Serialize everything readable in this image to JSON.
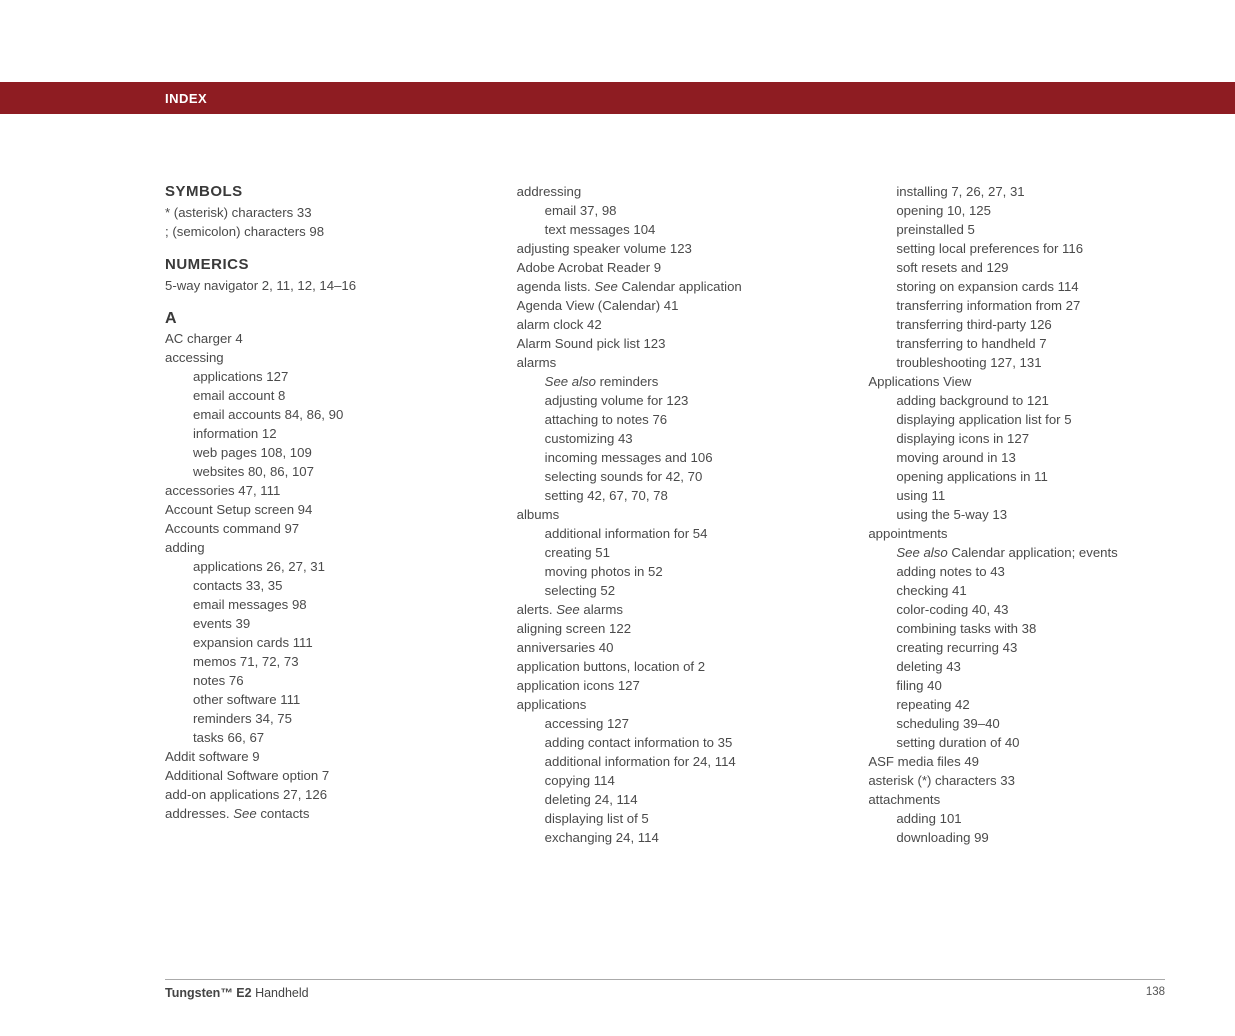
{
  "header": {
    "title": "INDEX"
  },
  "footer": {
    "product_bold": "Tungsten™ E2",
    "product_rest": " Handheld",
    "page": "138"
  },
  "col1": [
    {
      "cls": "heading",
      "txt": "SYMBOLS"
    },
    {
      "cls": "entry",
      "txt": "* (asterisk) characters 33"
    },
    {
      "cls": "entry",
      "txt": "; (semicolon) characters 98"
    },
    {
      "cls": "spacer"
    },
    {
      "cls": "heading",
      "txt": "NUMERICS"
    },
    {
      "cls": "entry",
      "txt": "5-way navigator 2, 11, 12, 14–16"
    },
    {
      "cls": "letter-heading",
      "txt": "A"
    },
    {
      "cls": "entry",
      "txt": "AC charger 4"
    },
    {
      "cls": "entry",
      "txt": "accessing"
    },
    {
      "cls": "sub1",
      "txt": "applications 127"
    },
    {
      "cls": "sub1",
      "txt": "email account 8"
    },
    {
      "cls": "sub1",
      "txt": "email accounts 84, 86, 90"
    },
    {
      "cls": "sub1",
      "txt": "information 12"
    },
    {
      "cls": "sub1",
      "txt": "web pages 108, 109"
    },
    {
      "cls": "sub1",
      "txt": "websites 80, 86, 107"
    },
    {
      "cls": "entry",
      "txt": "accessories 47, 111"
    },
    {
      "cls": "entry",
      "txt": "Account Setup screen 94"
    },
    {
      "cls": "entry",
      "txt": "Accounts command 97"
    },
    {
      "cls": "entry",
      "txt": "adding"
    },
    {
      "cls": "sub1",
      "txt": "applications 26, 27, 31"
    },
    {
      "cls": "sub1",
      "txt": "contacts 33, 35"
    },
    {
      "cls": "sub1",
      "txt": "email messages 98"
    },
    {
      "cls": "sub1",
      "txt": "events 39"
    },
    {
      "cls": "sub1",
      "txt": "expansion cards 111"
    },
    {
      "cls": "sub1",
      "txt": "memos 71, 72, 73"
    },
    {
      "cls": "sub1",
      "txt": "notes 76"
    },
    {
      "cls": "sub1",
      "txt": "other software 111"
    },
    {
      "cls": "sub1",
      "txt": "reminders 34, 75"
    },
    {
      "cls": "sub1",
      "txt": "tasks 66, 67"
    },
    {
      "cls": "entry",
      "txt": "Addit software 9"
    },
    {
      "cls": "entry",
      "txt": "Additional Software option 7"
    },
    {
      "cls": "entry",
      "txt": "add-on applications 27, 126"
    },
    {
      "cls": "entry",
      "parts": [
        {
          "txt": "addresses. "
        },
        {
          "txt": "See",
          "italic": true
        },
        {
          "txt": " contacts"
        }
      ]
    }
  ],
  "col2": [
    {
      "cls": "entry",
      "txt": "addressing"
    },
    {
      "cls": "sub1",
      "txt": "email 37, 98"
    },
    {
      "cls": "sub1",
      "txt": "text messages 104"
    },
    {
      "cls": "entry",
      "txt": "adjusting speaker volume 123"
    },
    {
      "cls": "entry",
      "txt": "Adobe Acrobat Reader 9"
    },
    {
      "cls": "entry",
      "parts": [
        {
          "txt": "agenda lists. "
        },
        {
          "txt": "See",
          "italic": true
        },
        {
          "txt": " Calendar application"
        }
      ]
    },
    {
      "cls": "entry",
      "txt": "Agenda View (Calendar) 41"
    },
    {
      "cls": "entry",
      "txt": "alarm clock 42"
    },
    {
      "cls": "entry",
      "txt": "Alarm Sound pick list 123"
    },
    {
      "cls": "entry",
      "txt": "alarms"
    },
    {
      "cls": "sub1",
      "parts": [
        {
          "txt": "See also",
          "italic": true
        },
        {
          "txt": " reminders"
        }
      ]
    },
    {
      "cls": "sub1",
      "txt": "adjusting volume for 123"
    },
    {
      "cls": "sub1",
      "txt": "attaching to notes 76"
    },
    {
      "cls": "sub1",
      "txt": "customizing 43"
    },
    {
      "cls": "sub1",
      "txt": "incoming messages and 106"
    },
    {
      "cls": "sub1",
      "txt": "selecting sounds for 42, 70"
    },
    {
      "cls": "sub1",
      "txt": "setting 42, 67, 70, 78"
    },
    {
      "cls": "entry",
      "txt": "albums"
    },
    {
      "cls": "sub1",
      "txt": "additional information for 54"
    },
    {
      "cls": "sub1",
      "txt": "creating 51"
    },
    {
      "cls": "sub1",
      "txt": "moving photos in 52"
    },
    {
      "cls": "sub1",
      "txt": "selecting 52"
    },
    {
      "cls": "entry",
      "parts": [
        {
          "txt": "alerts. "
        },
        {
          "txt": "See",
          "italic": true
        },
        {
          "txt": " alarms"
        }
      ]
    },
    {
      "cls": "entry",
      "txt": "aligning screen 122"
    },
    {
      "cls": "entry",
      "txt": "anniversaries 40"
    },
    {
      "cls": "entry",
      "txt": "application buttons, location of 2"
    },
    {
      "cls": "entry",
      "txt": "application icons 127"
    },
    {
      "cls": "entry",
      "txt": "applications"
    },
    {
      "cls": "sub1",
      "txt": "accessing 127"
    },
    {
      "cls": "sub1",
      "txt": "adding contact information to 35"
    },
    {
      "cls": "sub1",
      "txt": "additional information for 24, 114"
    },
    {
      "cls": "sub1",
      "txt": "copying 114"
    },
    {
      "cls": "sub1",
      "txt": "deleting 24, 114"
    },
    {
      "cls": "sub1",
      "txt": "displaying list of 5"
    },
    {
      "cls": "sub1",
      "txt": "exchanging 24, 114"
    }
  ],
  "col3": [
    {
      "cls": "sub1",
      "txt": "installing 7, 26, 27, 31"
    },
    {
      "cls": "sub1",
      "txt": "opening 10, 125"
    },
    {
      "cls": "sub1",
      "txt": "preinstalled 5"
    },
    {
      "cls": "sub1",
      "txt": "setting local preferences for 116"
    },
    {
      "cls": "sub1",
      "txt": "soft resets and 129"
    },
    {
      "cls": "sub1",
      "txt": "storing on expansion cards 114"
    },
    {
      "cls": "sub1",
      "txt": "transferring information from 27"
    },
    {
      "cls": "sub1",
      "txt": "transferring third-party 126"
    },
    {
      "cls": "sub1",
      "txt": "transferring to handheld 7"
    },
    {
      "cls": "sub1",
      "txt": "troubleshooting 127, 131"
    },
    {
      "cls": "entry",
      "txt": "Applications View"
    },
    {
      "cls": "sub1",
      "txt": "adding background to 121"
    },
    {
      "cls": "sub1",
      "txt": "displaying application list for 5"
    },
    {
      "cls": "sub1",
      "txt": "displaying icons in 127"
    },
    {
      "cls": "sub1",
      "txt": "moving around in 13"
    },
    {
      "cls": "sub1",
      "txt": "opening applications in 11"
    },
    {
      "cls": "sub1",
      "txt": "using 11"
    },
    {
      "cls": "sub1",
      "txt": "using the 5-way 13"
    },
    {
      "cls": "entry",
      "txt": "appointments"
    },
    {
      "cls": "sub1",
      "parts": [
        {
          "txt": "See also",
          "italic": true
        },
        {
          "txt": " Calendar application; events"
        }
      ]
    },
    {
      "cls": "sub1",
      "txt": "adding notes to 43"
    },
    {
      "cls": "sub1",
      "txt": "checking 41"
    },
    {
      "cls": "sub1",
      "txt": "color-coding 40, 43"
    },
    {
      "cls": "sub1",
      "txt": "combining tasks with 38"
    },
    {
      "cls": "sub1",
      "txt": "creating recurring 43"
    },
    {
      "cls": "sub1",
      "txt": "deleting 43"
    },
    {
      "cls": "sub1",
      "txt": "filing 40"
    },
    {
      "cls": "sub1",
      "txt": "repeating 42"
    },
    {
      "cls": "sub1",
      "txt": "scheduling 39–40"
    },
    {
      "cls": "sub1",
      "txt": "setting duration of 40"
    },
    {
      "cls": "entry",
      "txt": "ASF media files 49"
    },
    {
      "cls": "entry",
      "txt": "asterisk (*) characters 33"
    },
    {
      "cls": "entry",
      "txt": "attachments"
    },
    {
      "cls": "sub1",
      "txt": "adding 101"
    },
    {
      "cls": "sub1",
      "txt": "downloading 99"
    }
  ]
}
